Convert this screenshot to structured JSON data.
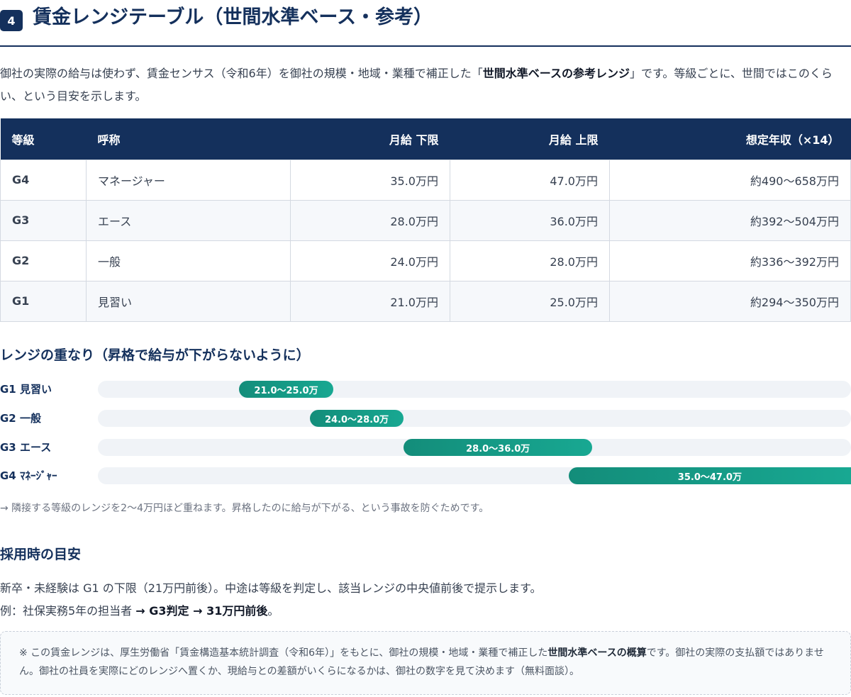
{
  "section": {
    "number": "4",
    "title": "賃金レンジテーブル（世間水準ベース・参考）"
  },
  "intro": {
    "part1": "御社の実際の給与は使わず、賃金センサス（令和6年）を御社の規模・地域・業種で補正した「",
    "bold": "世間水準ベースの参考レンジ",
    "part2": "」です。等級ごとに、世間ではこのくらい、という目安を示します。"
  },
  "table": {
    "headers": {
      "grade": "等級",
      "title": "呼称",
      "low": "月給 下限",
      "high": "月給 上限",
      "annual": "想定年収（×14）"
    },
    "rows": [
      {
        "grade": "G4",
        "title": "マネージャー",
        "low": "35.0万円",
        "high": "47.0万円",
        "annual": "約490〜658万円"
      },
      {
        "grade": "G3",
        "title": "エース",
        "low": "28.0万円",
        "high": "36.0万円",
        "annual": "約392〜504万円"
      },
      {
        "grade": "G2",
        "title": "一般",
        "low": "24.0万円",
        "high": "28.0万円",
        "annual": "約336〜392万円"
      },
      {
        "grade": "G1",
        "title": "見習い",
        "low": "21.0万円",
        "high": "25.0万円",
        "annual": "約294〜350万円"
      }
    ]
  },
  "overlap": {
    "title": "レンジの重なり（昇格で給与が下がらないように）",
    "bars": [
      {
        "label": "G1 見習い",
        "low": 21.0,
        "high": 25.0,
        "text": "21.0〜25.0万"
      },
      {
        "label": "G2 一般",
        "low": 24.0,
        "high": 28.0,
        "text": "24.0〜28.0万"
      },
      {
        "label": "G3 エース",
        "low": 28.0,
        "high": 36.0,
        "text": "28.0〜36.0万"
      },
      {
        "label": "G4 ﾏﾈｰｼﾞｬｰ",
        "low": 35.0,
        "high": 47.0,
        "text": "35.0〜47.0万"
      }
    ],
    "note": "→ 隣接する等級のレンジを2〜4万円ほど重ねます。昇格したのに給与が下がる、という事故を防ぐためです。"
  },
  "hiring": {
    "title": "採用時の目安",
    "line1": "新卒・未経験は G1 の下限（21万円前後）。中途は等級を判定し、該当レンジの中央値前後で提示します。",
    "line2_prefix": "例：社保実務5年の担当者 ",
    "line2_bold": "→ G3判定 → 31万円前後",
    "line2_suffix": "。"
  },
  "disclaimer": {
    "part1": "※ この賃金レンジは、厚生労働省「賃金構造基本統計調査（令和6年）」をもとに、御社の規模・地域・業種で補正した",
    "bold": "世間水準ベースの概算",
    "part2": "です。御社の実際の支払額ではありません。御社の社員を実際にどのレンジへ置くか、現給与との差額がいくらになるかは、御社の数字を見て決めます（無料面談）。"
  },
  "colors": {
    "navy": "#14305c",
    "teal": "#138d7a",
    "track": "#f0f3f7"
  }
}
